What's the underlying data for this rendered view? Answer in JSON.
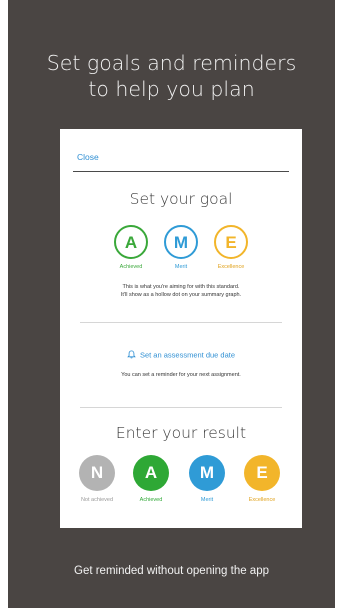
{
  "headline": {
    "line1": "Set goals and reminders",
    "line2": "to help you plan"
  },
  "phone": {
    "close_label": "Close",
    "goal": {
      "title": "Set your goal",
      "options": [
        {
          "letter": "A",
          "label": "Achieved",
          "color": "#3aa83a"
        },
        {
          "letter": "M",
          "label": "Merit",
          "color": "#2f9bd6"
        },
        {
          "letter": "E",
          "label": "Excellence",
          "color": "#f2b52a"
        }
      ],
      "description_line1": "This is what you're aiming for with this standard.",
      "description_line2": "It'll show as a hollow dot on your summary graph."
    },
    "reminder": {
      "icon": "bell-icon",
      "link_label": "Set an assessment due date",
      "description": "You can set a reminder for your next assignment."
    },
    "result": {
      "title": "Enter your result",
      "options": [
        {
          "letter": "N",
          "label": "Not achieved",
          "color": "#b3b3b3"
        },
        {
          "letter": "A",
          "label": "Achieved",
          "color": "#2ea835"
        },
        {
          "letter": "M",
          "label": "Merit",
          "color": "#2f9bd6"
        },
        {
          "letter": "E",
          "label": "Excellence",
          "color": "#f2b52a"
        }
      ]
    }
  },
  "footer": "Get reminded without opening the app"
}
